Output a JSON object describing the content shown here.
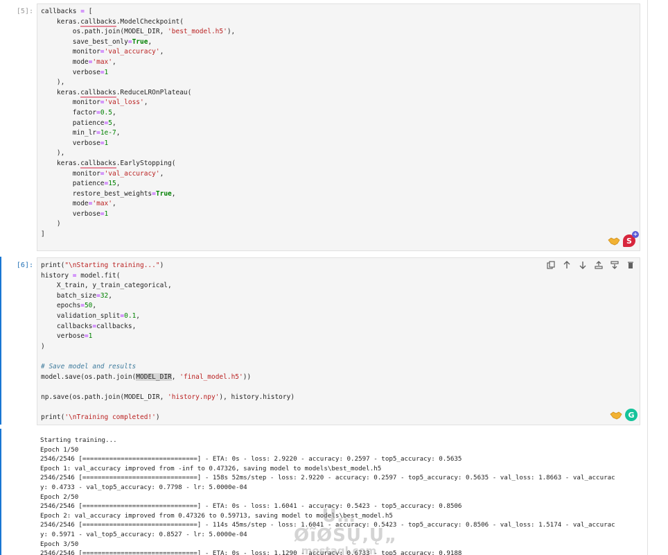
{
  "cells": {
    "cell5": {
      "prompt": "[5]:",
      "lines": [
        "callbacks = [",
        "    keras.callbacks.ModelCheckpoint(",
        "        os.path.join(MODEL_DIR, 'best_model.h5'),",
        "        save_best_only=True,",
        "        monitor='val_accuracy',",
        "        mode='max',",
        "        verbose=1",
        "    ),",
        "    keras.callbacks.ReduceLROnPlateau(",
        "        monitor='val_loss',",
        "        factor=0.5,",
        "        patience=5,",
        "        min_lr=1e-7,",
        "        verbose=1",
        "    ),",
        "    keras.callbacks.EarlyStopping(",
        "        monitor='val_accuracy',",
        "        patience=15,",
        "        restore_best_weights=True,",
        "        mode='max',",
        "        verbose=1",
        "    )",
        "]"
      ]
    },
    "cell6": {
      "prompt": "[6]:",
      "lines": [
        "print(\"\\nStarting training...\")",
        "history = model.fit(",
        "    X_train, y_train_categorical,",
        "    batch_size=32,",
        "    epochs=50,",
        "    validation_split=0.1,",
        "    callbacks=callbacks,",
        "    verbose=1",
        ")",
        "",
        "# Save model and results",
        "model.save(os.path.join(MODEL_DIR, 'final_model.h5'))",
        "",
        "np.save(os.path.join(MODEL_DIR, 'history.npy'), history.history)",
        "",
        "print('\\nTraining completed!')"
      ]
    },
    "output": {
      "lines": [
        "Starting training...",
        "Epoch 1/50",
        "2546/2546 [==============================] - ETA: 0s - loss: 2.9220 - accuracy: 0.2597 - top5_accuracy: 0.5635",
        "Epoch 1: val_accuracy improved from -inf to 0.47326, saving model to models\\best_model.h5",
        "2546/2546 [==============================] - 158s 52ms/step - loss: 2.9220 - accuracy: 0.2597 - top5_accuracy: 0.5635 - val_loss: 1.8663 - val_accurac",
        "y: 0.4733 - val_top5_accuracy: 0.7798 - lr: 5.0000e-04",
        "Epoch 2/50",
        "2546/2546 [==============================] - ETA: 0s - loss: 1.6041 - accuracy: 0.5423 - top5_accuracy: 0.8506",
        "Epoch 2: val_accuracy improved from 0.47326 to 0.59713, saving model to models\\best_model.h5",
        "2546/2546 [==============================] - 114s 45ms/step - loss: 1.6041 - accuracy: 0.5423 - top5_accuracy: 0.8506 - val_loss: 1.5174 - val_accurac",
        "y: 0.5971 - val_top5_accuracy: 0.8527 - lr: 5.0000e-04",
        "Epoch 3/50",
        "2546/2546 [==============================] - ETA: 0s - loss: 1.1290 - accuracy: 0.6733 - top5_accuracy: 0.9188"
      ]
    }
  },
  "toolbar": {
    "icons": [
      "copy-icon",
      "arrow-up-icon",
      "arrow-down-icon",
      "insert-above-icon",
      "insert-below-icon",
      "delete-icon"
    ]
  },
  "extensions": {
    "grammarly_letter": "G",
    "red_ext_letter": "S",
    "red_ext_plus": "+"
  },
  "watermark": {
    "line1": "Ū…ØĩØŠŲ‚Ų„",
    "line2": "mostaql.com"
  },
  "colors": {
    "selection_bar": "#1976d2",
    "editor_bg": "#f5f5f5",
    "string": "#ba2121",
    "keyword": "#008000",
    "comment": "#3d7a9c"
  }
}
